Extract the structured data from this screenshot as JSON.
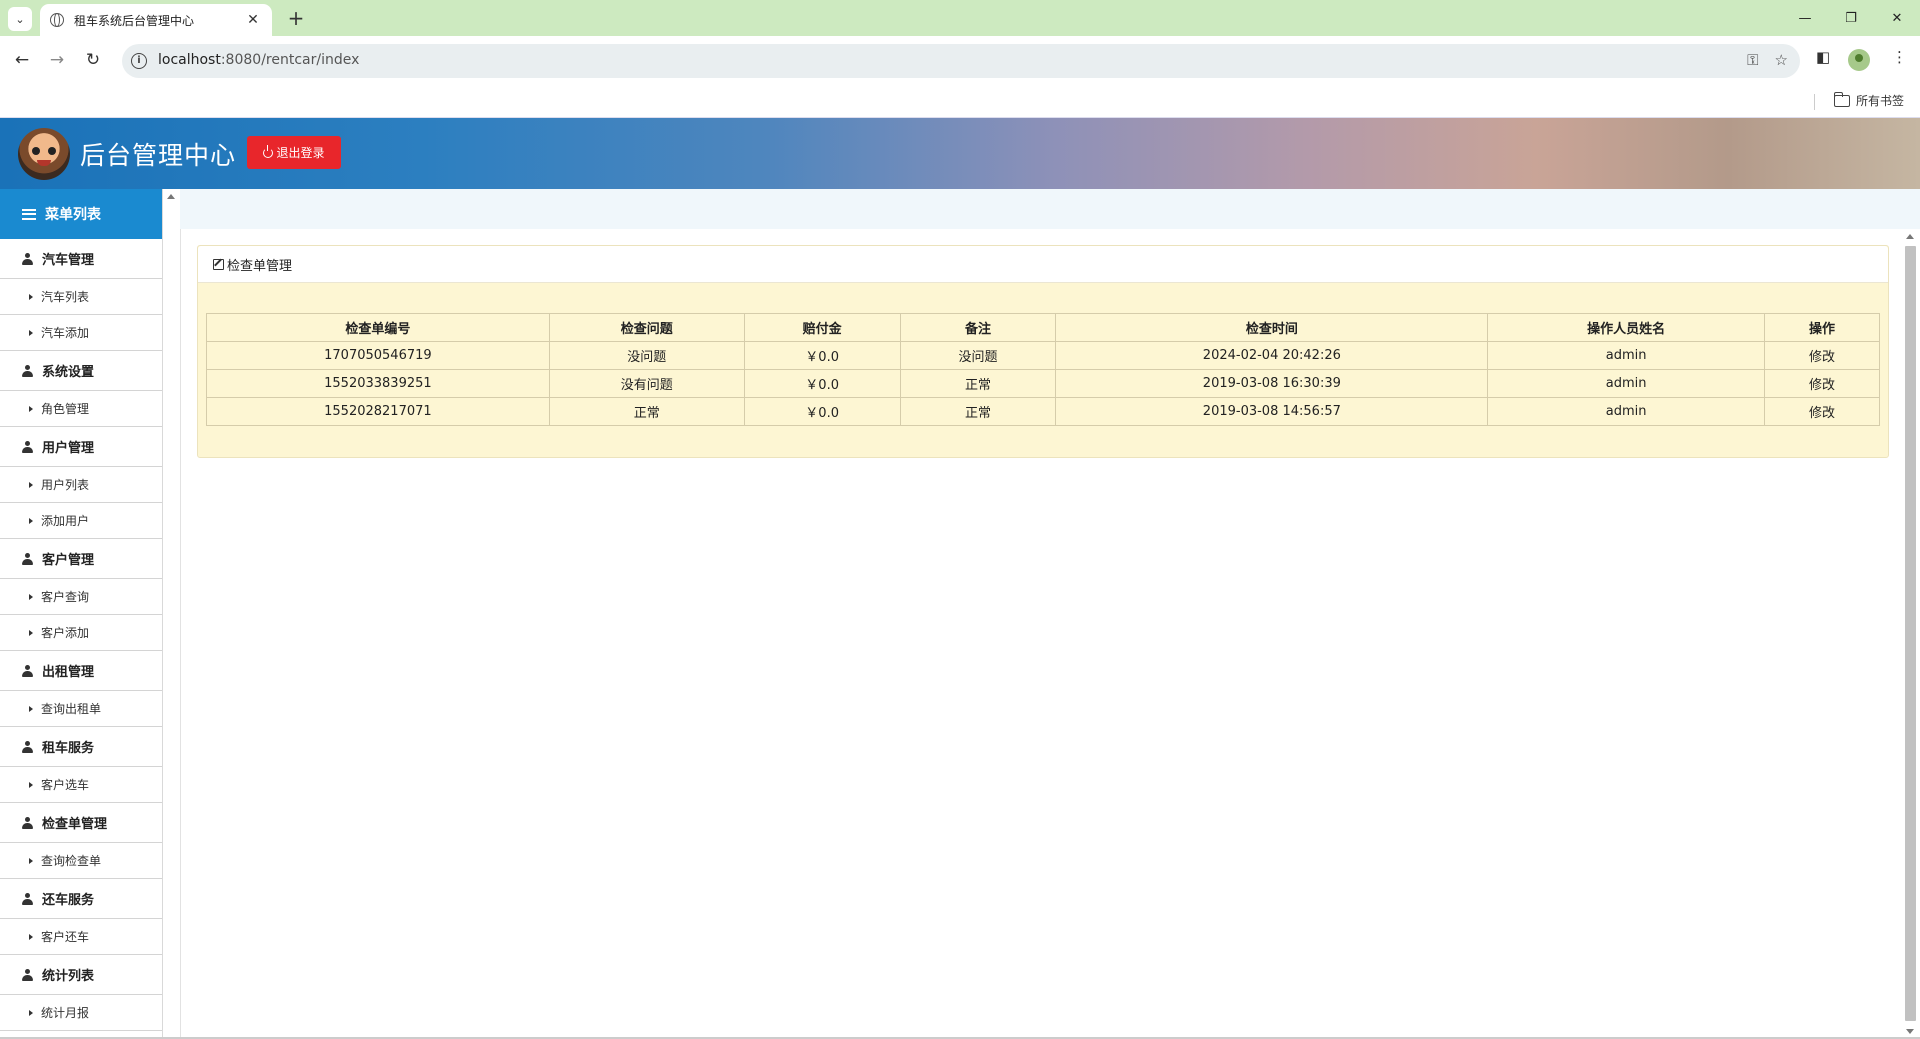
{
  "browser": {
    "tab_title": "租车系统后台管理中心",
    "url_host": "localhost",
    "url_rest": ":8080/rentcar/index",
    "bookmarks_all": "所有书签"
  },
  "header": {
    "title": "后台管理中心",
    "logout_label": "退出登录"
  },
  "sidebar": {
    "title": "菜单列表",
    "groups": [
      {
        "label": "汽车管理",
        "items": [
          "汽车列表",
          "汽车添加"
        ]
      },
      {
        "label": "系统设置",
        "items": [
          "角色管理"
        ]
      },
      {
        "label": "用户管理",
        "items": [
          "用户列表",
          "添加用户"
        ]
      },
      {
        "label": "客户管理",
        "items": [
          "客户查询",
          "客户添加"
        ]
      },
      {
        "label": "出租管理",
        "items": [
          "查询出租单"
        ]
      },
      {
        "label": "租车服务",
        "items": [
          "客户选车"
        ]
      },
      {
        "label": "检查单管理",
        "items": [
          "查询检查单"
        ]
      },
      {
        "label": "还车服务",
        "items": [
          "客户还车"
        ]
      },
      {
        "label": "统计列表",
        "items": [
          "统计月报"
        ]
      }
    ]
  },
  "panel": {
    "title": "检查单管理",
    "columns": [
      "检查单编号",
      "检查问题",
      "赔付金",
      "备注",
      "检查时间",
      "操作人员姓名",
      "操作"
    ],
    "rows": [
      [
        "1707050546719",
        "没问题",
        "￥0.0",
        "没问题",
        "2024-02-04 20:42:26",
        "admin",
        "修改"
      ],
      [
        "1552033839251",
        "没有问题",
        "￥0.0",
        "正常",
        "2019-03-08 16:30:39",
        "admin",
        "修改"
      ],
      [
        "1552028217071",
        "正常",
        "￥0.0",
        "正常",
        "2019-03-08 14:56:57",
        "admin",
        "修改"
      ]
    ]
  }
}
